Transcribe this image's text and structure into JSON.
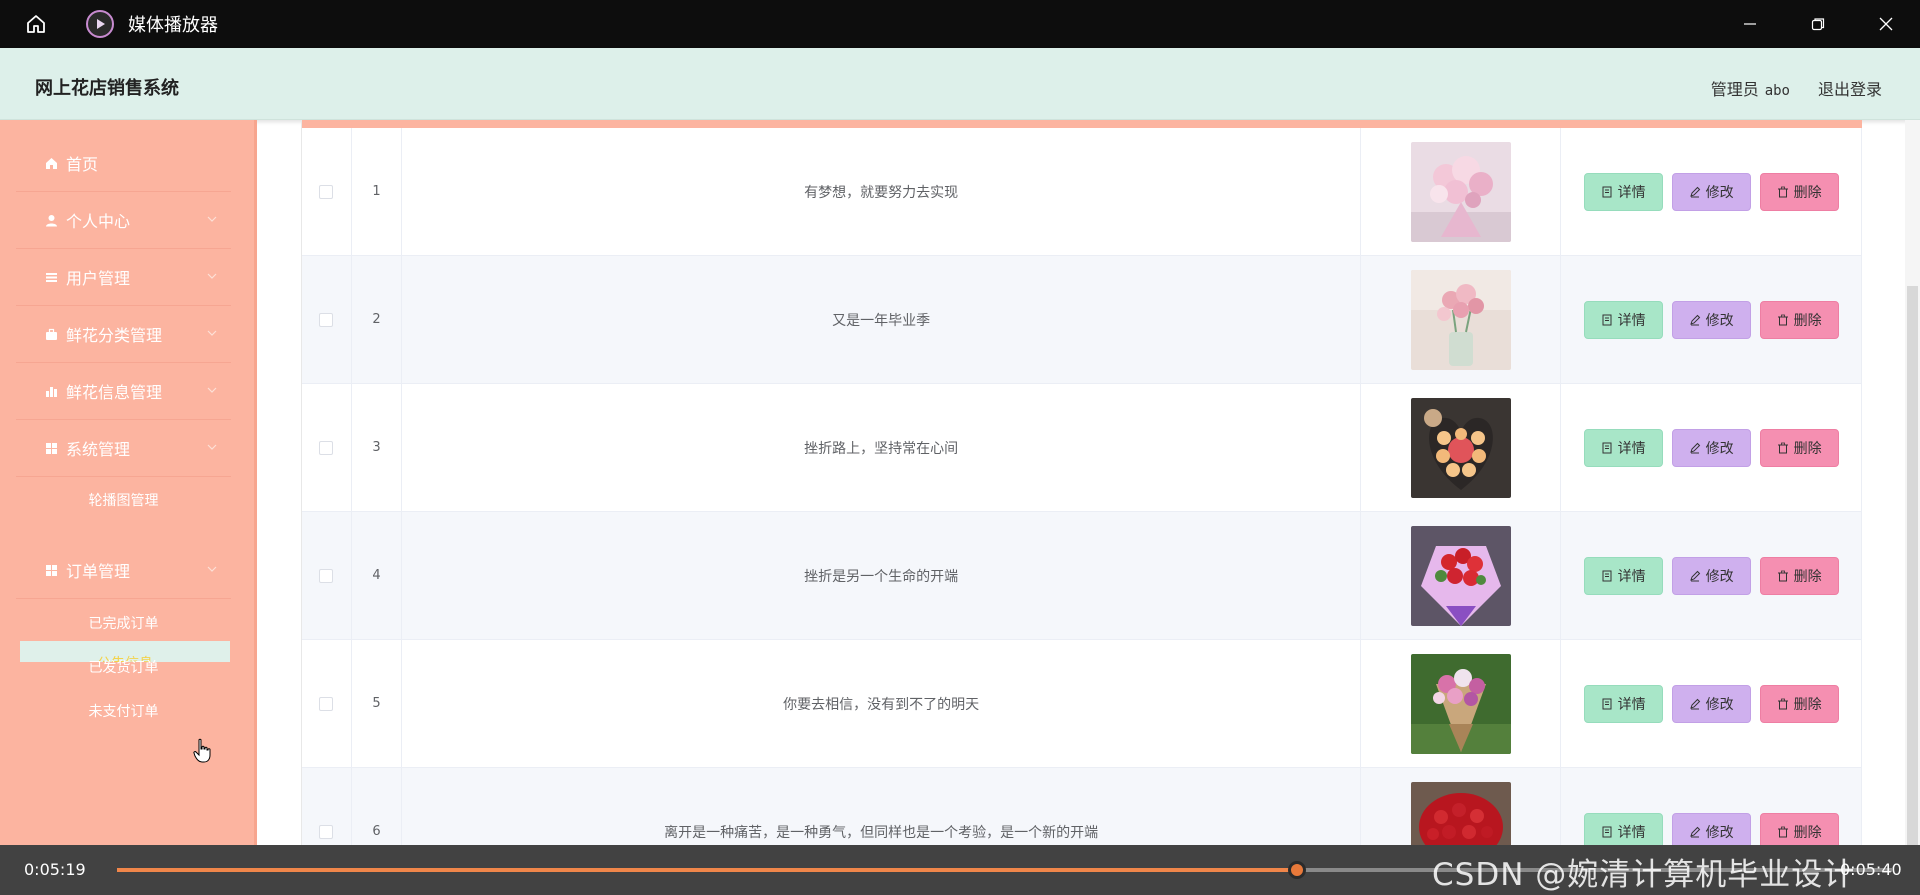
{
  "player": {
    "title": "媒体播放器",
    "time_current": "0:05:19",
    "time_total": "0:05:40",
    "progress": 0.665,
    "watermark": "CSDN @婉清计算机毕业设计",
    "accent_color": "#e8793a"
  },
  "header": {
    "title": "网上花店销售系统",
    "user_label": "管理员",
    "username": "abo",
    "logout": "退出登录"
  },
  "sidebar": {
    "items": [
      {
        "label": "首页",
        "icon": "home-icon",
        "has_chevron": false
      },
      {
        "label": "个人中心",
        "icon": "user-icon",
        "has_chevron": true
      },
      {
        "label": "用户管理",
        "icon": "list-icon",
        "has_chevron": true
      },
      {
        "label": "鲜花分类管理",
        "icon": "briefcase-icon",
        "has_chevron": true
      },
      {
        "label": "鲜花信息管理",
        "icon": "bar-chart-icon",
        "has_chevron": true
      },
      {
        "label": "系统管理",
        "icon": "grid-icon",
        "has_chevron": true
      },
      {
        "label": "订单管理",
        "icon": "grid-icon",
        "has_chevron": true
      }
    ],
    "system_sub": [
      {
        "label": "轮播图管理"
      },
      {
        "label": "公告信息",
        "active": true
      }
    ],
    "order_sub": [
      {
        "label": "已完成订单"
      },
      {
        "label": "已发货订单"
      },
      {
        "label": "未支付订单"
      }
    ],
    "bg_color": "#fcb4a0"
  },
  "table": {
    "rows": [
      {
        "index": "1",
        "title": "有梦想，就要努力去实现",
        "flower": "pink-bouquet"
      },
      {
        "index": "2",
        "title": "又是一年毕业季",
        "flower": "pink-vase"
      },
      {
        "index": "3",
        "title": "挫折路上，坚持常在心间",
        "flower": "heart-box"
      },
      {
        "index": "4",
        "title": "挫折是另一个生命的开端",
        "flower": "red-roses-purple"
      },
      {
        "index": "5",
        "title": "你要去相信，没有到不了的明天",
        "flower": "mixed-bouquet"
      },
      {
        "index": "6",
        "title": "离开是一种痛苦，是一种勇气，但同样也是一个考验，是一个新的开端",
        "flower": "red-rose-basket"
      }
    ],
    "actions": {
      "detail": "详情",
      "edit": "修改",
      "delete": "删除"
    }
  }
}
